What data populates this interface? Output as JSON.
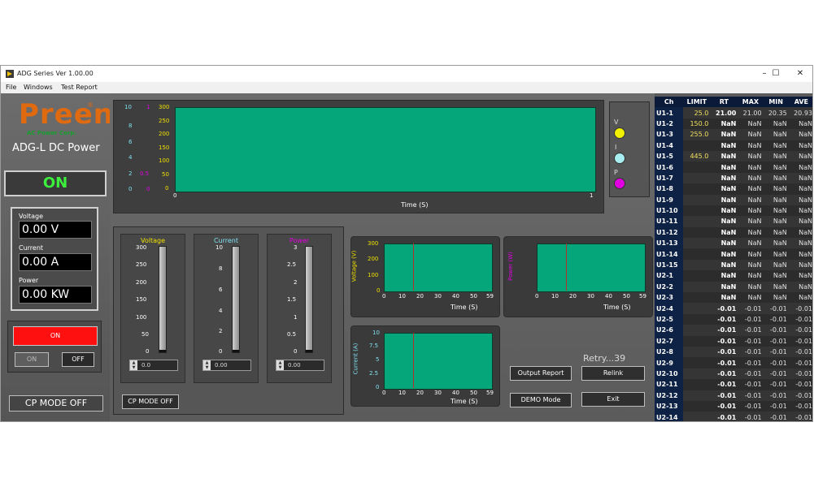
{
  "window": {
    "title": "ADG Series Ver 1.00.00",
    "minimize": "–",
    "maximize": "☐",
    "close": "✕"
  },
  "menu": [
    "File",
    "Windows",
    "Test Report"
  ],
  "brand": {
    "logo": "Preen",
    "registered": "®",
    "subtitle": "AC Power Corp.",
    "product": "ADG-L DC Power"
  },
  "status": {
    "state": "ON"
  },
  "readings": {
    "voltage_label": "Voltage",
    "voltage_value": "0.00 V",
    "current_label": "Current",
    "current_value": "0.00 A",
    "power_label": "Power",
    "power_value": "0.00 KW"
  },
  "output": {
    "on_button": "ON",
    "on_small": "ON",
    "off_small": "OFF",
    "cp_mode": "CP MODE OFF"
  },
  "main_chart": {
    "v_ticks": [
      "10",
      "8",
      "6",
      "4",
      "2",
      "0"
    ],
    "i_ticks": [
      "1",
      "",
      "",
      "",
      "0.5",
      "0"
    ],
    "p_ticks": [
      "300",
      "250",
      "200",
      "150",
      "100",
      "50",
      "0"
    ],
    "x_start": "0",
    "x_end": "1",
    "xlabel": "Time (S)"
  },
  "legend": {
    "v": "V",
    "i": "I",
    "p": "P",
    "v_color": "#f0f000",
    "i_color": "#a8eef0",
    "p_color": "#e000e0"
  },
  "meters": [
    {
      "title": "Voltage",
      "color": "#f0e000",
      "ticks": [
        "300",
        "250",
        "200",
        "150",
        "100",
        "50",
        "0"
      ],
      "level": 0,
      "setpoint": "0.0"
    },
    {
      "title": "Current",
      "color": "#7fe0f0",
      "ticks": [
        "10",
        "8",
        "6",
        "4",
        "2",
        "0"
      ],
      "level": 0,
      "setpoint": "0.00"
    },
    {
      "title": "Power",
      "color": "#e000e0",
      "ticks": [
        "3",
        "2.5",
        "2",
        "1.5",
        "1",
        "0.5",
        "0"
      ],
      "level": 0,
      "setpoint": "0.00"
    }
  ],
  "mode_button": "CP MODE OFF",
  "small_charts": {
    "voltage": {
      "ylabel": "Voltage (V)",
      "yticks": [
        "300",
        "200",
        "100",
        "0"
      ],
      "xlabel": "Time (S)"
    },
    "power": {
      "ylabel": "Power (W)",
      "yticks": [
        "",
        "",
        "",
        ""
      ],
      "xlabel": "Time (S)"
    },
    "current": {
      "ylabel": "Current (A)",
      "yticks": [
        "10",
        "7.5",
        "5",
        "2.5",
        "0"
      ],
      "xlabel": "Time (S)"
    },
    "xticks": [
      "0",
      "10",
      "20",
      "30",
      "40",
      "50",
      "59"
    ]
  },
  "actions": {
    "retry": "Retry...39",
    "output_report": "Output Report",
    "relink": "Relink",
    "demo_mode": "DEMO Mode",
    "exit": "Exit"
  },
  "table": {
    "headers": [
      "Ch",
      "LIMIT",
      "RT",
      "MAX",
      "MIN",
      "AVE"
    ],
    "rows": [
      [
        "U1-1",
        "25.0",
        "21.00",
        "21.00",
        "20.35",
        "20.93"
      ],
      [
        "U1-2",
        "150.0",
        "NaN",
        "NaN",
        "NaN",
        "NaN"
      ],
      [
        "U1-3",
        "255.0",
        "NaN",
        "NaN",
        "NaN",
        "NaN"
      ],
      [
        "U1-4",
        "",
        "NaN",
        "NaN",
        "NaN",
        "NaN"
      ],
      [
        "U1-5",
        "445.0",
        "NaN",
        "NaN",
        "NaN",
        "NaN"
      ],
      [
        "U1-6",
        "",
        "NaN",
        "NaN",
        "NaN",
        "NaN"
      ],
      [
        "U1-7",
        "",
        "NaN",
        "NaN",
        "NaN",
        "NaN"
      ],
      [
        "U1-8",
        "",
        "NaN",
        "NaN",
        "NaN",
        "NaN"
      ],
      [
        "U1-9",
        "",
        "NaN",
        "NaN",
        "NaN",
        "NaN"
      ],
      [
        "U1-10",
        "",
        "NaN",
        "NaN",
        "NaN",
        "NaN"
      ],
      [
        "U1-11",
        "",
        "NaN",
        "NaN",
        "NaN",
        "NaN"
      ],
      [
        "U1-12",
        "",
        "NaN",
        "NaN",
        "NaN",
        "NaN"
      ],
      [
        "U1-13",
        "",
        "NaN",
        "NaN",
        "NaN",
        "NaN"
      ],
      [
        "U1-14",
        "",
        "NaN",
        "NaN",
        "NaN",
        "NaN"
      ],
      [
        "U1-15",
        "",
        "NaN",
        "NaN",
        "NaN",
        "NaN"
      ],
      [
        "U2-1",
        "",
        "NaN",
        "NaN",
        "NaN",
        "NaN"
      ],
      [
        "U2-2",
        "",
        "NaN",
        "NaN",
        "NaN",
        "NaN"
      ],
      [
        "U2-3",
        "",
        "NaN",
        "NaN",
        "NaN",
        "NaN"
      ],
      [
        "U2-4",
        "",
        "-0.01",
        "-0.01",
        "-0.01",
        "-0.01"
      ],
      [
        "U2-5",
        "",
        "-0.01",
        "-0.01",
        "-0.01",
        "-0.01"
      ],
      [
        "U2-6",
        "",
        "-0.01",
        "-0.01",
        "-0.01",
        "-0.01"
      ],
      [
        "U2-7",
        "",
        "-0.01",
        "-0.01",
        "-0.01",
        "-0.01"
      ],
      [
        "U2-8",
        "",
        "-0.01",
        "-0.01",
        "-0.01",
        "-0.01"
      ],
      [
        "U2-9",
        "",
        "-0.01",
        "-0.01",
        "-0.01",
        "-0.01"
      ],
      [
        "U2-10",
        "",
        "-0.01",
        "-0.01",
        "-0.01",
        "-0.01"
      ],
      [
        "U2-11",
        "",
        "-0.01",
        "-0.01",
        "-0.01",
        "-0.01"
      ],
      [
        "U2-12",
        "",
        "-0.01",
        "-0.01",
        "-0.01",
        "-0.01"
      ],
      [
        "U2-13",
        "",
        "-0.01",
        "-0.01",
        "-0.01",
        "-0.01"
      ],
      [
        "U2-14",
        "",
        "-0.01",
        "-0.01",
        "-0.01",
        "-0.01"
      ]
    ]
  },
  "colors": {
    "plot": "#04a67a",
    "cursor": "#b33030",
    "on_red": "#ff1010",
    "on_green": "#3cf03c",
    "table_header": "#0b1a38"
  }
}
